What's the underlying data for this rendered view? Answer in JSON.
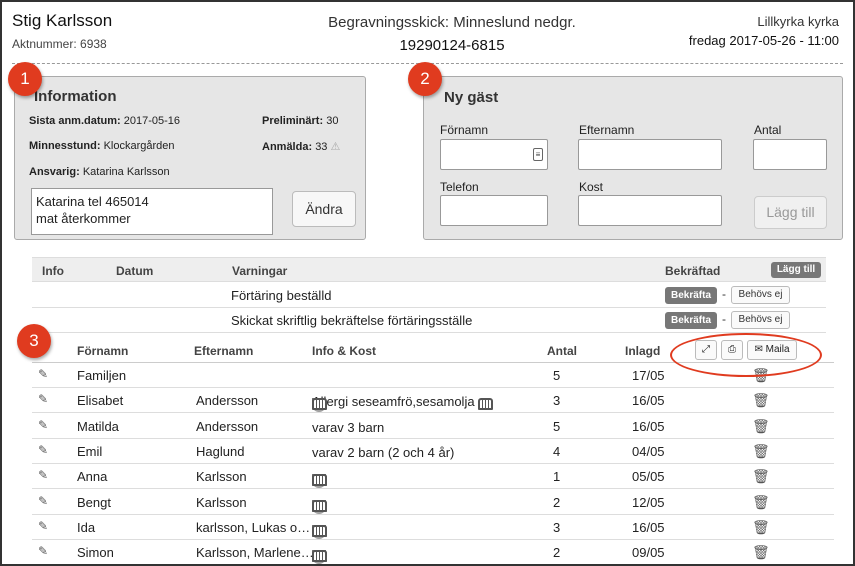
{
  "header": {
    "name": "Stig Karlsson",
    "akt": "Aktnummer: 6938",
    "burial": "Begravningsskick: Minneslund nedgr.",
    "pnr": "19290124-6815",
    "church": "Lillkyrka kyrka",
    "datetime": "fredag 2017-05-26 - 11:00"
  },
  "badges": [
    "1",
    "2",
    "3"
  ],
  "info": {
    "title": "Information",
    "sista_label": "Sista anm.datum:",
    "sista_value": "2017-05-16",
    "prelim_label": "Preliminärt:",
    "prelim_value": "30",
    "minnesstund_label": "Minnesstund:",
    "minnesstund_value": "Klockargården",
    "anmalda_label": "Anmälda:",
    "anmalda_value": "33",
    "ansvarig_label": "Ansvarig:",
    "ansvarig_value": "Katarina Karlsson",
    "notes": "Katarina tel 465014\nmat återkommer",
    "change_label": "Ändra"
  },
  "guest_form": {
    "title": "Ny gäst",
    "fornamn": "Förnamn",
    "efternamn": "Efternamn",
    "antal": "Antal",
    "telefon": "Telefon",
    "kost": "Kost",
    "add_label": "Lägg till"
  },
  "warnings": {
    "headers": {
      "info": "Info",
      "datum": "Datum",
      "varningar": "Varningar",
      "bekraftad": "Bekräftad",
      "add": "Lägg till"
    },
    "rows": [
      {
        "text": "Förtäring beställd",
        "confirm": "Bekräfta",
        "sep": "-",
        "not_needed": "Behövs ej"
      },
      {
        "text": "Skickat skriftlig bekräftelse förtäringsställe",
        "confirm": "Bekräfta",
        "sep": "-",
        "not_needed": "Behövs ej"
      }
    ]
  },
  "guests": {
    "headers": {
      "fornamn": "Förnamn",
      "efternamn": "Efternamn",
      "info": "Info & Kost",
      "antal": "Antal",
      "inlagd": "Inlagd"
    },
    "mail_label": "Maila",
    "rows": [
      {
        "fornamn": "Familjen",
        "efternamn": "",
        "info_text": "",
        "icons": [],
        "antal": "5",
        "inlagd": "17/05"
      },
      {
        "fornamn": "Elisabet",
        "efternamn": "Andersson",
        "info_text": "Allergi seseamfrö,sesamolja",
        "icons": [
          "globe",
          "mail",
          "phone"
        ],
        "icon_after": "phone",
        "antal": "3",
        "inlagd": "16/05"
      },
      {
        "fornamn": "Matilda",
        "efternamn": "Andersson",
        "info_text": "varav 3 barn",
        "icons": [],
        "antal": "5",
        "inlagd": "16/05"
      },
      {
        "fornamn": "Emil",
        "efternamn": "Haglund",
        "info_text": "varav 2 barn (2 och 4 år)",
        "icons": [],
        "antal": "4",
        "inlagd": "04/05"
      },
      {
        "fornamn": "Anna",
        "efternamn": "Karlsson",
        "info_text": "",
        "icons": [
          "globe",
          "mail",
          "phone",
          "phone"
        ],
        "antal": "1",
        "inlagd": "05/05"
      },
      {
        "fornamn": "Bengt",
        "efternamn": "Karlsson",
        "info_text": "",
        "icons": [
          "globe",
          "mail",
          "phone",
          "phone"
        ],
        "antal": "2",
        "inlagd": "12/05"
      },
      {
        "fornamn": "Ida",
        "efternamn": "karlsson, Lukas o…",
        "info_text": "",
        "icons": [
          "globe",
          "mail",
          "phone",
          "phone"
        ],
        "antal": "3",
        "inlagd": "16/05"
      },
      {
        "fornamn": "Simon",
        "efternamn": "Karlsson, Marlene…",
        "info_text": "",
        "icons": [
          "globe",
          "mail",
          "phone",
          "phone"
        ],
        "antal": "2",
        "inlagd": "09/05"
      }
    ]
  },
  "colors": {
    "badge": "#e03b1f",
    "panel": "#e6e6e6",
    "dark_button": "#777777"
  }
}
